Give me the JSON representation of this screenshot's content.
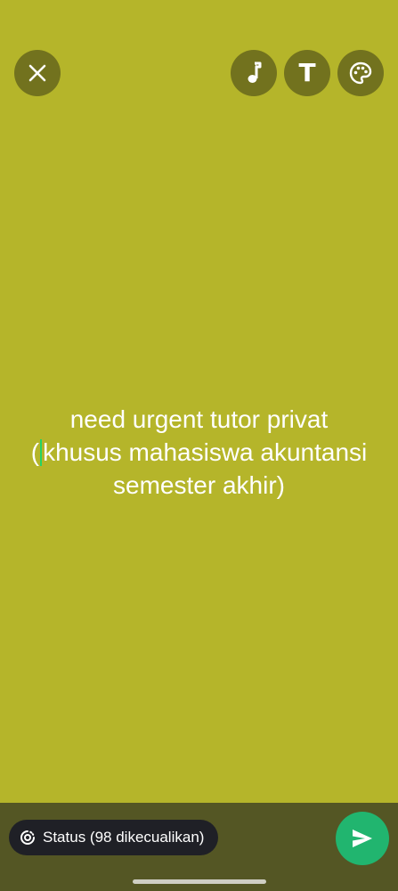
{
  "colors": {
    "background": "#b5b52a",
    "bottom_bar": "#545624",
    "pill": "#1f2026",
    "send": "#21b56f",
    "caret": "#25d366"
  },
  "toolbar": {
    "close_icon": "close-icon",
    "music_icon": "music-note-icon",
    "text_icon": "text-format-icon",
    "text_icon_glyph": "T",
    "palette_icon": "palette-icon"
  },
  "status_text": {
    "line1": "need urgent tutor privat",
    "line2_before_caret": "(",
    "line2_after_caret": "khusus mahasiswa akuntansi",
    "line3": "semester akhir)"
  },
  "bottom": {
    "privacy_icon": "status-ring-icon",
    "privacy_label": "Status (98 dikecualikan)",
    "send_icon": "send-icon"
  }
}
